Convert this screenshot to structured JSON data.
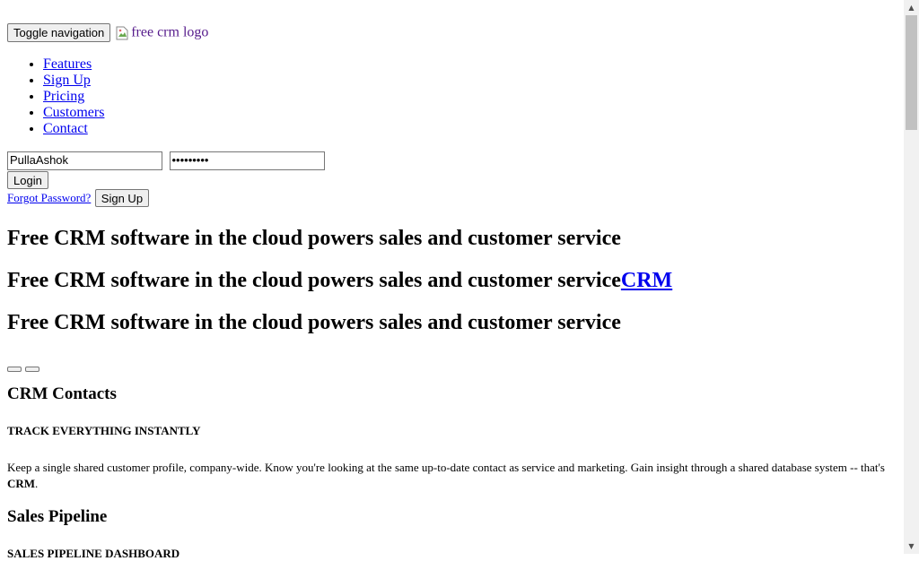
{
  "header": {
    "toggle_label": "Toggle navigation",
    "logo_alt": "free crm logo"
  },
  "nav": {
    "items": [
      {
        "label": "Features"
      },
      {
        "label": "Sign Up"
      },
      {
        "label": "Pricing"
      },
      {
        "label": "Customers"
      },
      {
        "label": "Contact"
      }
    ]
  },
  "login": {
    "username_value": "PullaAshok",
    "password_value": "•••••••••",
    "login_label": "Login",
    "forgot_label": "Forgot Password?",
    "signup_label": "Sign Up"
  },
  "hero": {
    "heading_1": "Free CRM software in the cloud powers sales and customer service",
    "heading_2": "Free CRM software in the cloud powers sales and customer service",
    "heading_2_link": "CRM",
    "heading_3": "Free CRM software in the cloud powers sales and customer service"
  },
  "sections": {
    "contacts_title": "CRM Contacts",
    "contacts_subtitle": "TRACK EVERYTHING INSTANTLY",
    "contacts_body": "Keep a single shared customer profile, company-wide. Know you're looking at the same up-to-date contact as service and marketing. Gain insight through a shared database system -- that's ",
    "contacts_body_bold": "CRM",
    "contacts_body_end": ".",
    "pipeline_title": "Sales Pipeline",
    "pipeline_subtitle": "SALES PIPELINE DASHBOARD"
  },
  "scrollbar": {
    "up_icon": "triangle-up",
    "down_icon": "triangle-down"
  }
}
